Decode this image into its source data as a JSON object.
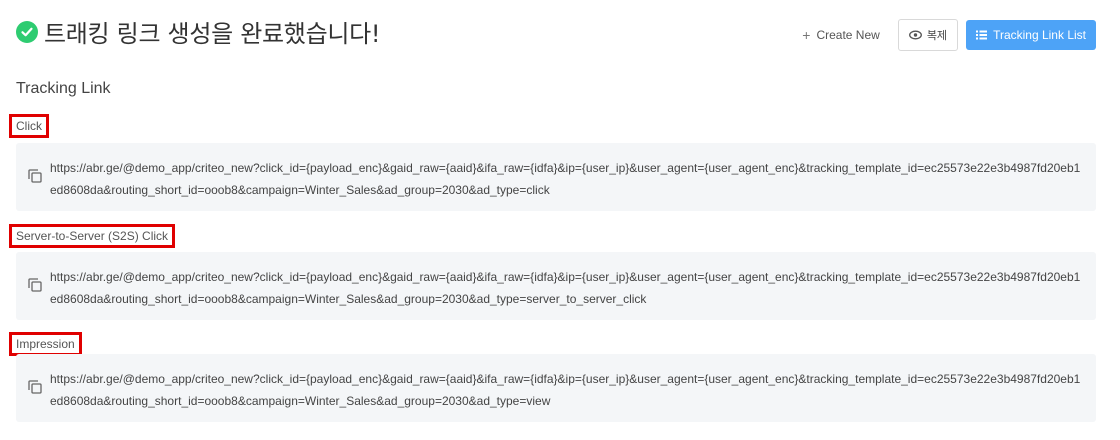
{
  "header": {
    "title": "트래킹 링크 생성을 완료했습니다!",
    "success_icon": "check-circle-icon",
    "success_color": "#2ecc71"
  },
  "actions": {
    "create_new_label": "Create New",
    "duplicate_label": "복제",
    "tracking_link_list_label": "Tracking Link List",
    "primary_color": "#4da3f7"
  },
  "section": {
    "title": "Tracking Link"
  },
  "links": [
    {
      "label": "Click",
      "url": "https://abr.ge/@demo_app/criteo_new?click_id={payload_enc}&gaid_raw={aaid}&ifa_raw={idfa}&ip={user_ip}&user_agent={user_agent_enc}&tracking_template_id=ec25573e22e3b4987fd20eb1ed8608da&routing_short_id=ooob8&campaign=Winter_Sales&ad_group=2030&ad_type=click"
    },
    {
      "label": "Server-to-Server (S2S) Click",
      "url": "https://abr.ge/@demo_app/criteo_new?click_id={payload_enc}&gaid_raw={aaid}&ifa_raw={idfa}&ip={user_ip}&user_agent={user_agent_enc}&tracking_template_id=ec25573e22e3b4987fd20eb1ed8608da&routing_short_id=ooob8&campaign=Winter_Sales&ad_group=2030&ad_type=server_to_server_click"
    },
    {
      "label": "Impression",
      "url": "https://abr.ge/@demo_app/criteo_new?click_id={payload_enc}&gaid_raw={aaid}&ifa_raw={idfa}&ip={user_ip}&user_agent={user_agent_enc}&tracking_template_id=ec25573e22e3b4987fd20eb1ed8608da&routing_short_id=ooob8&campaign=Winter_Sales&ad_group=2030&ad_type=view"
    }
  ],
  "highlight_color": "#e00000"
}
